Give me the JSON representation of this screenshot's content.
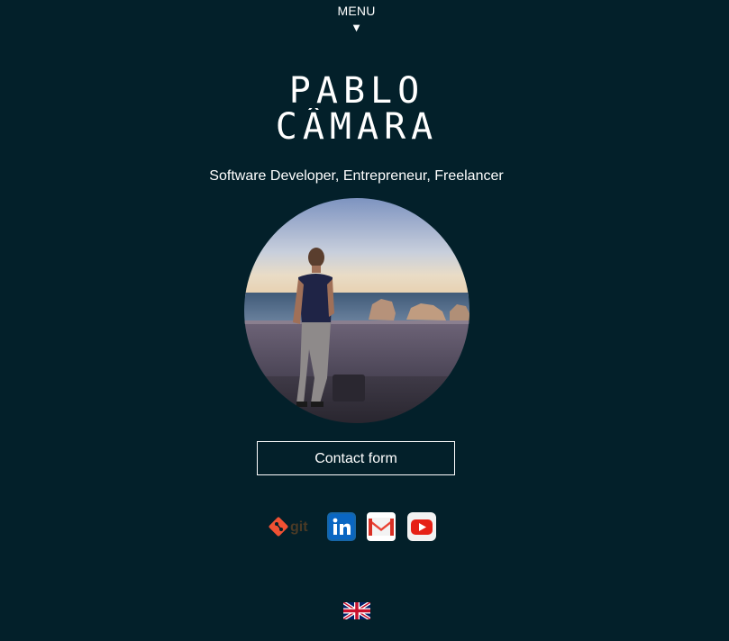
{
  "nav": {
    "menu_label": "MENU",
    "menu_arrow": "▼"
  },
  "header": {
    "title_line1": "PABLO",
    "title_line2": "CÂMARA",
    "subtitle": "Software Developer, Entrepreneur, Freelancer"
  },
  "profile": {
    "avatar_icon": "profile-photo"
  },
  "actions": {
    "contact_label": "Contact form"
  },
  "social": {
    "git_label": "git",
    "git_color": "#f05133",
    "linkedin_color": "#0a66c2",
    "gmail_color": "#ea4335",
    "youtube_color": "#ff0000"
  },
  "language": {
    "flag_icon": "uk-flag-icon"
  },
  "colors": {
    "background": "#03202a",
    "text": "#ffffff"
  }
}
